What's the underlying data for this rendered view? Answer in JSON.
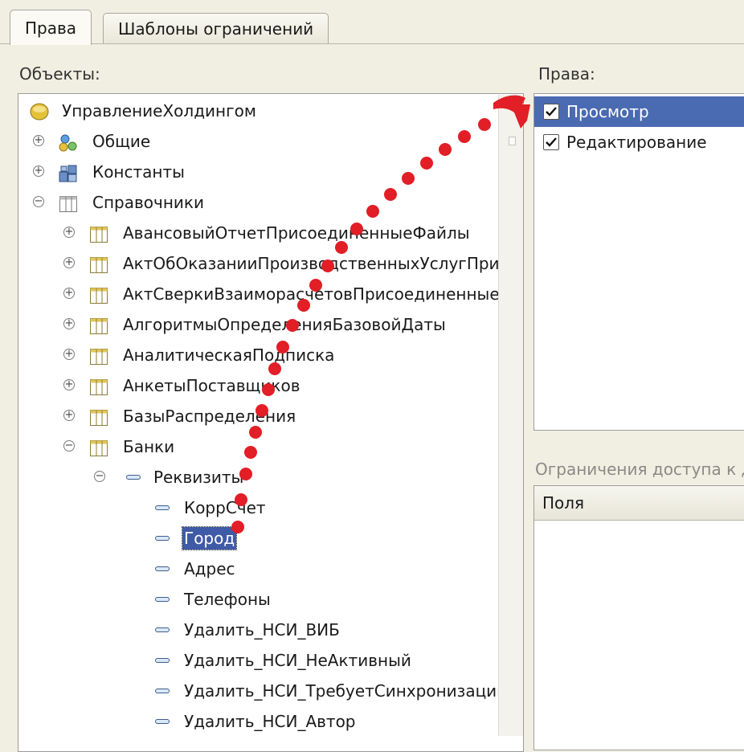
{
  "tabs": [
    {
      "label": "Права",
      "active": true
    },
    {
      "label": "Шаблоны ограничений",
      "active": false
    }
  ],
  "objects_caption": "Объекты:",
  "rights_caption": "Права:",
  "restrictions_caption": "Ограничения доступа к да",
  "tree": {
    "root": "УправлениеХолдингом",
    "top": [
      {
        "label": "Общие",
        "icon": "common-icon",
        "expander": "+"
      },
      {
        "label": "Константы",
        "icon": "constants-icon",
        "expander": "+"
      },
      {
        "label": "Справочники",
        "icon": "catalog-icon",
        "expander": "−"
      }
    ],
    "catalogs": [
      {
        "label": "АвансовыйОтчетПрисоединенныеФайлы",
        "expander": "+"
      },
      {
        "label": "АктОбОказанииПроизводственныхУслугПрис",
        "expander": "+"
      },
      {
        "label": "АктСверкиВзаиморасчетовПрисоединенныеФ",
        "expander": "+"
      },
      {
        "label": "АлгоритмыОпределенияБазовойДаты",
        "expander": "+"
      },
      {
        "label": "АналитическаяПодписка",
        "expander": "+"
      },
      {
        "label": "АнкетыПоставщиков",
        "expander": "+"
      },
      {
        "label": "БазыРаспределения",
        "expander": "+"
      },
      {
        "label": "Банки",
        "expander": "−"
      }
    ],
    "requisites_label": "Реквизиты",
    "attributes": [
      {
        "label": "КоррСчет",
        "selected": false
      },
      {
        "label": "Город",
        "selected": true
      },
      {
        "label": "Адрес",
        "selected": false
      },
      {
        "label": "Телефоны",
        "selected": false
      },
      {
        "label": "Удалить_НСИ_ВИБ",
        "selected": false
      },
      {
        "label": "Удалить_НСИ_НеАктивный",
        "selected": false
      },
      {
        "label": "Удалить_НСИ_ТребуетСинхронизации",
        "selected": false
      },
      {
        "label": "Удалить_НСИ_Автор",
        "selected": false
      }
    ]
  },
  "rights": [
    {
      "label": "Просмотр",
      "checked": true,
      "selected": true
    },
    {
      "label": "Редактирование",
      "checked": true,
      "selected": false
    }
  ],
  "fields_header": "Поля",
  "colors": {
    "selection": "#3f5aa6",
    "arrow": "#e21e26",
    "background": "#f1efe2"
  }
}
